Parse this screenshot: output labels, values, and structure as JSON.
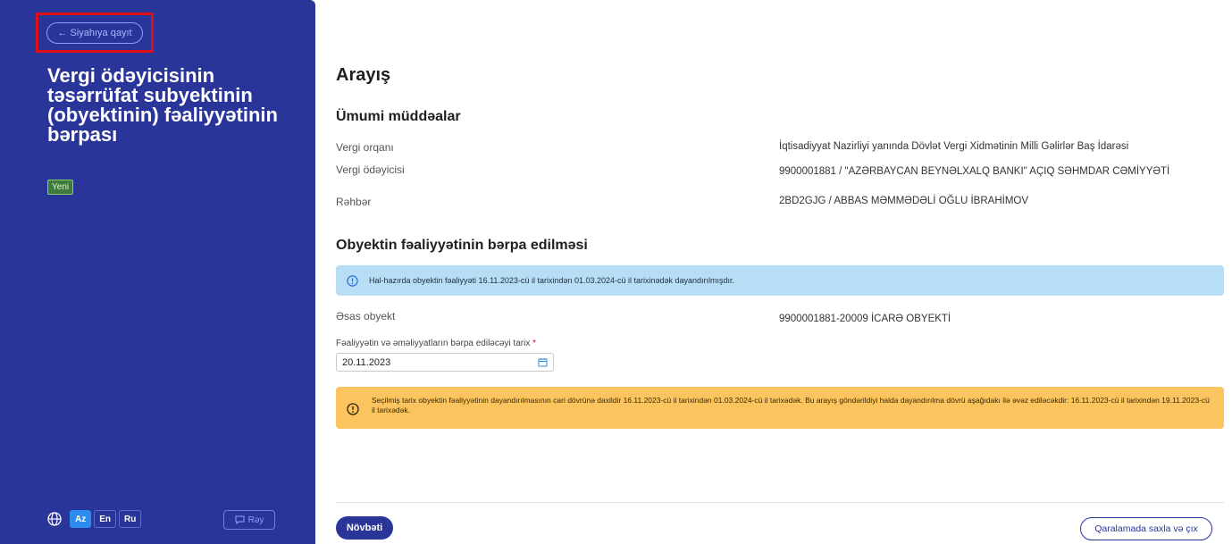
{
  "sidebar": {
    "back_label": "← Siyahıya qayıt",
    "title": "Vergi ödəyicisinin təsərrüfat subyektinin (obyektinin) fəaliyyətinin bərpası",
    "badge": "Yeni",
    "languages": [
      {
        "label": "Az",
        "active": true
      },
      {
        "label": "En",
        "active": false
      },
      {
        "label": "Ru",
        "active": false
      }
    ],
    "rey_label": "Rəy"
  },
  "main": {
    "page_title": "Arayış",
    "section_general": "Ümumi müddəalar",
    "general_rows": [
      {
        "label": "Vergi orqanı",
        "value": "İqtisadiyyat Nazirliyi yanında Dövlət Vergi Xidmətinin Milli Gəlirlər Baş İdarəsi"
      },
      {
        "label": "Vergi ödəyicisi",
        "value": "9900001881 / \"AZƏRBAYCAN BEYNƏLXALQ BANKI\" AÇIQ SƏHMDAR CƏMİYYƏTİ"
      },
      {
        "label": "Rəhbər",
        "value": "2BD2GJG / ABBAS MƏMMƏDƏLİ OĞLU İBRAHİMOV"
      }
    ],
    "section_restore": "Obyektin fəaliyyətinin bərpa edilməsi",
    "info_alert": "Hal-hazırda obyektin fəaliyyəti 16.11.2023-cü il tarixindən 01.03.2024-cü il tarixinədək dayandırılmışdır.",
    "object_label": "Əsas obyekt",
    "object_value": "9900001881-20009 İCARƏ OBYEKTİ",
    "date_label": "Fəaliyyətin və əməliyyatların bərpa ediləcəyi tarix",
    "date_required": "*",
    "date_value": "20.11.2023",
    "warning_alert": "Seçilmiş tarix obyektin fəaliyyətinin dayandırılmasının cari dövrünə daxildir 16.11.2023-cü il tarixindən 01.03.2024-cü il tarixədək. Bu arayış göndərildiyi halda dayandırılma dövrü aşağıdakı ilə əvəz ediləcəkdir: 16.11.2023-cü il tarixindən 19.11.2023-cü il tarixədək.",
    "next_label": "Növbəti",
    "draft_label": "Qaralamada saxla və çıx"
  },
  "colors": {
    "sidebar_bg": "#2a3599",
    "info_bg": "#b7def5",
    "warning_bg": "#fcc45e",
    "highlight": "#e0101a"
  }
}
